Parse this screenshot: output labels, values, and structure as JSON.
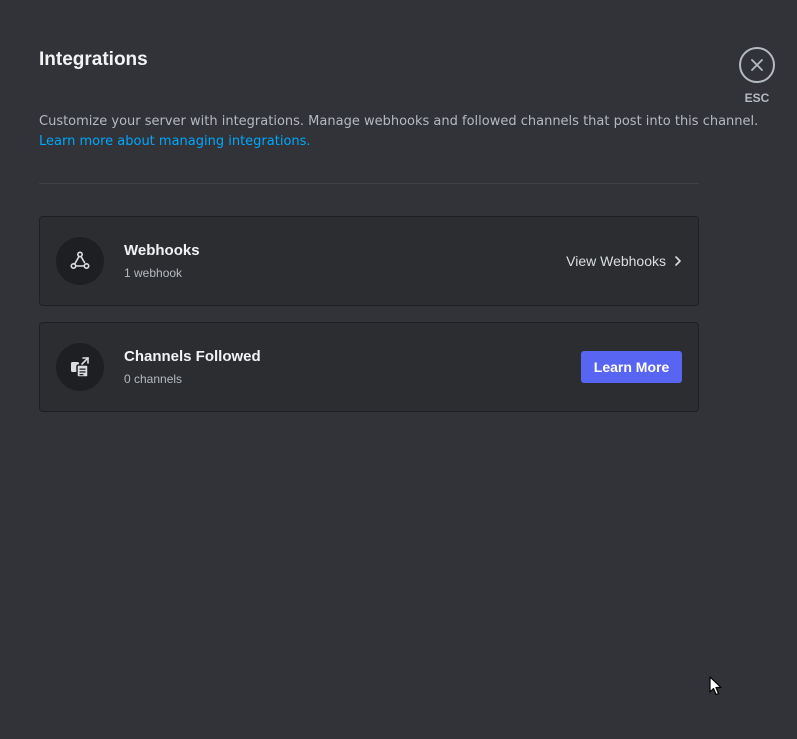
{
  "header": {
    "title": "Integrations",
    "description": "Customize your server with integrations. Manage webhooks and followed channels that post into this channel.",
    "learn_more_link": "Learn more about managing integrations."
  },
  "close": {
    "icon": "close-icon",
    "label": "ESC"
  },
  "cards": {
    "webhooks": {
      "icon": "webhook-icon",
      "title": "Webhooks",
      "subtitle": "1 webhook",
      "action_label": "View Webhooks",
      "action_icon": "chevron-right-icon"
    },
    "channels": {
      "icon": "channel-follow-icon",
      "title": "Channels Followed",
      "subtitle": "0 channels",
      "action_label": "Learn More"
    }
  },
  "colors": {
    "background": "#313338",
    "card": "#2b2d31",
    "accent": "#5865f2",
    "link": "#00a8fc"
  }
}
